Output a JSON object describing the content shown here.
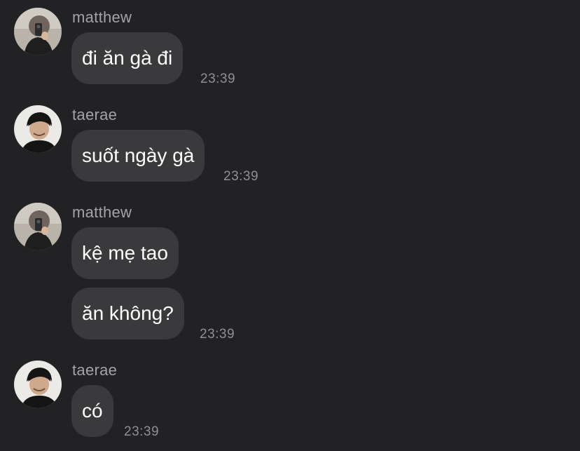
{
  "messages": [
    {
      "sender": "matthew",
      "texts": [
        "đi ăn gà đi"
      ],
      "time": "23:39"
    },
    {
      "sender": "taerae",
      "texts": [
        "suốt ngày gà"
      ],
      "time": "23:39"
    },
    {
      "sender": "matthew",
      "texts": [
        "kệ mẹ tao",
        "ăn không?"
      ],
      "time": "23:39"
    },
    {
      "sender": "taerae",
      "texts": [
        "có"
      ],
      "time": "23:39"
    }
  ],
  "colors": {
    "background": "#222224",
    "bubble": "#3a3a3c",
    "text": "#ffffff",
    "meta": "#a3a3a8"
  },
  "icons": {
    "matthew_avatar": "avatar-matthew-icon",
    "taerae_avatar": "avatar-taerae-icon"
  }
}
